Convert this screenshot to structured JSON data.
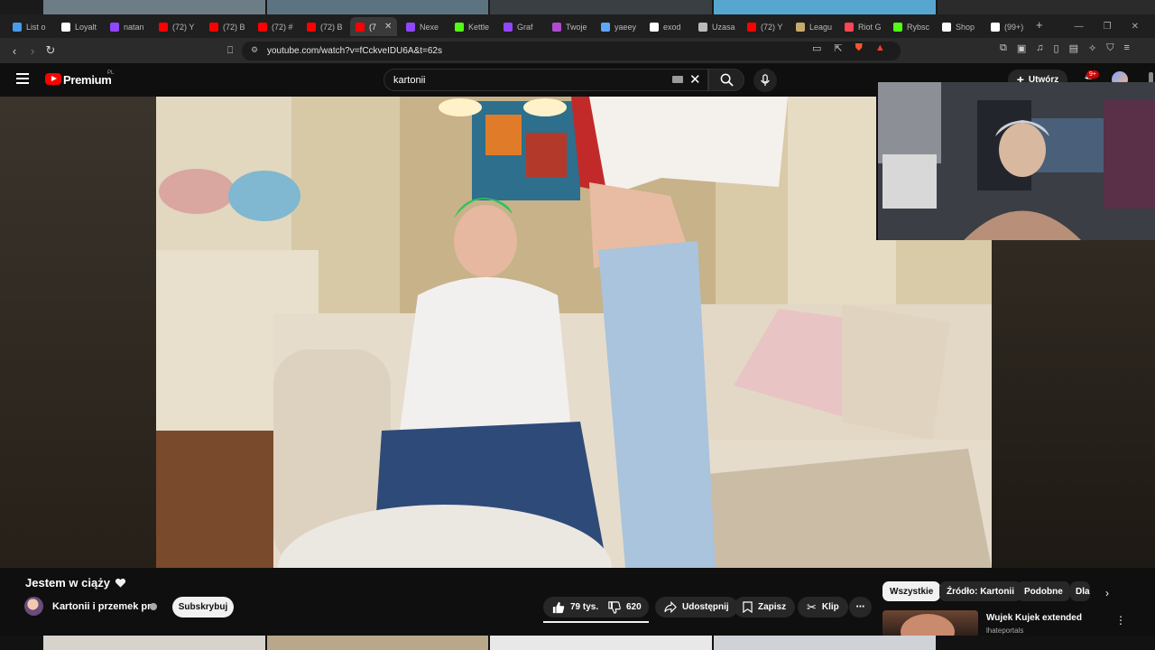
{
  "browser": {
    "tabs": [
      {
        "label": "List o",
        "color": "#4a9be8"
      },
      {
        "label": "Loyalt",
        "color": "#ffffff"
      },
      {
        "label": "natan",
        "color": "#9146ff"
      },
      {
        "label": "(72) Y",
        "color": "#ff0000"
      },
      {
        "label": "(72) B",
        "color": "#ff0000"
      },
      {
        "label": "(72) #",
        "color": "#ff0000"
      },
      {
        "label": "(72) B",
        "color": "#ff0000"
      },
      {
        "label": "(7",
        "color": "#ff0000"
      },
      {
        "label": "Nexe",
        "color": "#9146ff"
      },
      {
        "label": "Kettle",
        "color": "#53fc18"
      },
      {
        "label": "Graf",
        "color": "#9146ff"
      },
      {
        "label": "Twoje",
        "color": "#b04ad0"
      },
      {
        "label": "yaeey",
        "color": "#60a5fa"
      },
      {
        "label": "exod",
        "color": "#ffffff"
      },
      {
        "label": "Uzasa",
        "color": "#bbbbbb"
      },
      {
        "label": "(72) Y",
        "color": "#ff0000"
      },
      {
        "label": "Leagu",
        "color": "#c8aa6e"
      },
      {
        "label": "Riot G",
        "color": "#ff4655"
      },
      {
        "label": "Rybsc",
        "color": "#53fc18"
      },
      {
        "label": "Shop",
        "color": "#ffffff"
      },
      {
        "label": "(99+)",
        "color": "#ffffff"
      }
    ],
    "active_tab_index": 7,
    "new_tab": "+",
    "url": "youtube.com/watch?v=fCckveIDU6A&t=62s"
  },
  "youtube": {
    "brand": "Premium",
    "region": "PL",
    "search_value": "kartonii",
    "create_label": "Utwórz",
    "notifications": "9+"
  },
  "video": {
    "title": "Jestem w ciąży",
    "channel": "Kartonii i przemek pro",
    "subscribe_label": "Subskrybuj",
    "likes": "79 tys.",
    "dislikes": "620",
    "share_label": "Udostępnij",
    "save_label": "Zapisz",
    "clip_label": "Klip",
    "more_label": "⋯"
  },
  "chips": [
    "Wszystkie",
    "Źródło: Kartonii",
    "Podobne",
    "Dla"
  ],
  "recommendation": {
    "title": "Wujek Kujek extended",
    "channel": "lhateportals"
  }
}
